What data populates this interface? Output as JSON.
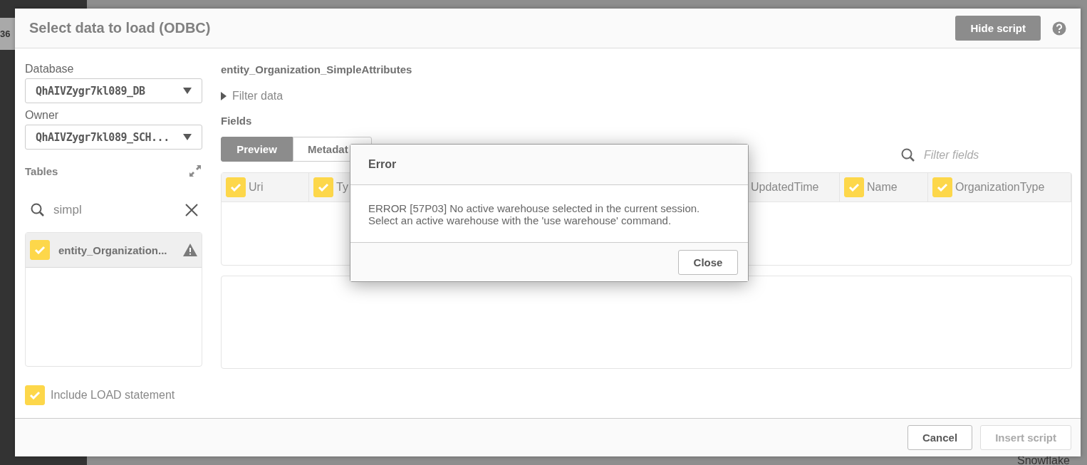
{
  "background": {
    "left_fragment": "36",
    "bottom_fragment": "Snowflake"
  },
  "dialog": {
    "title": "Select data to load (ODBC)",
    "hide_script": "Hide script"
  },
  "left_panel": {
    "database_label": "Database",
    "database_value": "QhAIVZygr7kl089_DB",
    "owner_label": "Owner",
    "owner_value": "QhAIVZygr7kl089_SCH...",
    "tables_label": "Tables",
    "search_value": "simpl",
    "tables": [
      {
        "name": "entity_Organization...",
        "checked": true,
        "selected": true,
        "warning": true
      }
    ],
    "include_load": {
      "label": "Include LOAD statement",
      "checked": true
    }
  },
  "right_panel": {
    "table_title": "entity_Organization_SimpleAttributes",
    "filter_data": "Filter data",
    "fields_label": "Fields",
    "tabs": [
      {
        "label": "Preview",
        "selected": true
      },
      {
        "label": "Metadat",
        "selected": false
      }
    ],
    "filter_placeholder": "Filter fields",
    "columns": [
      {
        "label": "Uri",
        "checked": true
      },
      {
        "label": "Ty",
        "checked": true
      },
      {
        "label": "UpdatedTime"
      },
      {
        "label": "Name",
        "checked": true
      },
      {
        "label": "OrganizationType",
        "checked": true
      }
    ]
  },
  "error_modal": {
    "title": "Error",
    "lines": [
      "ERROR [57P03] No active warehouse selected in the current session.",
      "Select an active warehouse with the 'use warehouse' command."
    ],
    "button": "Close"
  },
  "footer": {
    "buttons": [
      {
        "label": "Cancel",
        "disabled": false
      },
      {
        "label": "Insert script",
        "disabled": true
      }
    ]
  }
}
